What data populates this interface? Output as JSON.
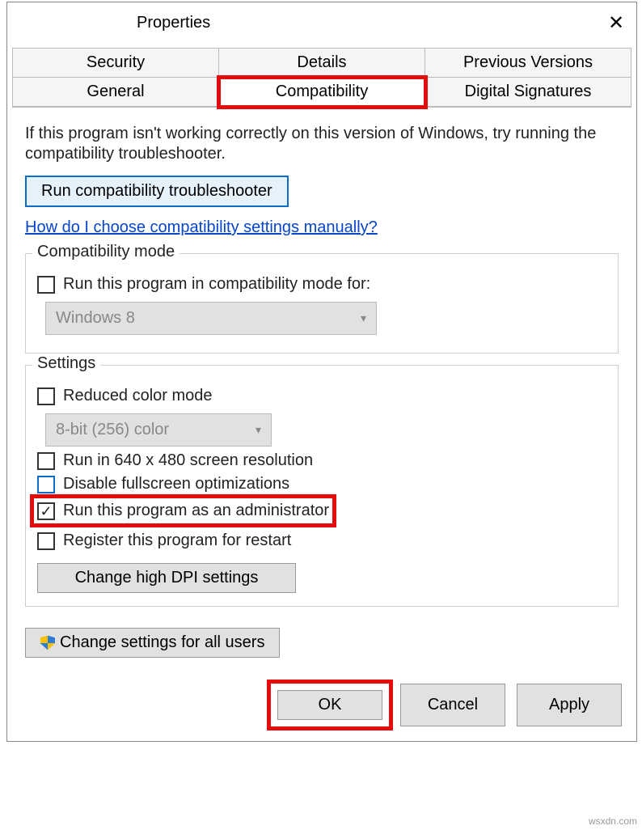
{
  "title": "Properties",
  "tabs": {
    "row1": [
      "Security",
      "Details",
      "Previous Versions"
    ],
    "row2": [
      "General",
      "Compatibility",
      "Digital Signatures"
    ]
  },
  "intro": "If this program isn't working correctly on this version of Windows, try running the compatibility troubleshooter.",
  "run_troubleshooter": "Run compatibility troubleshooter",
  "help_link": "How do I choose compatibility settings manually?",
  "compat_mode": {
    "legend": "Compatibility mode",
    "checkbox": "Run this program in compatibility mode for:",
    "combo": "Windows 8"
  },
  "settings": {
    "legend": "Settings",
    "reduced_color": "Reduced color mode",
    "color_combo": "8-bit (256) color",
    "res_640": "Run in 640 x 480 screen resolution",
    "disable_fullscreen": "Disable fullscreen optimizations",
    "run_admin": "Run this program as an administrator",
    "register_restart": "Register this program for restart",
    "high_dpi": "Change high DPI settings"
  },
  "all_users": "Change settings for all users",
  "footer": {
    "ok": "OK",
    "cancel": "Cancel",
    "apply": "Apply"
  },
  "watermark": "wsxdn.com"
}
